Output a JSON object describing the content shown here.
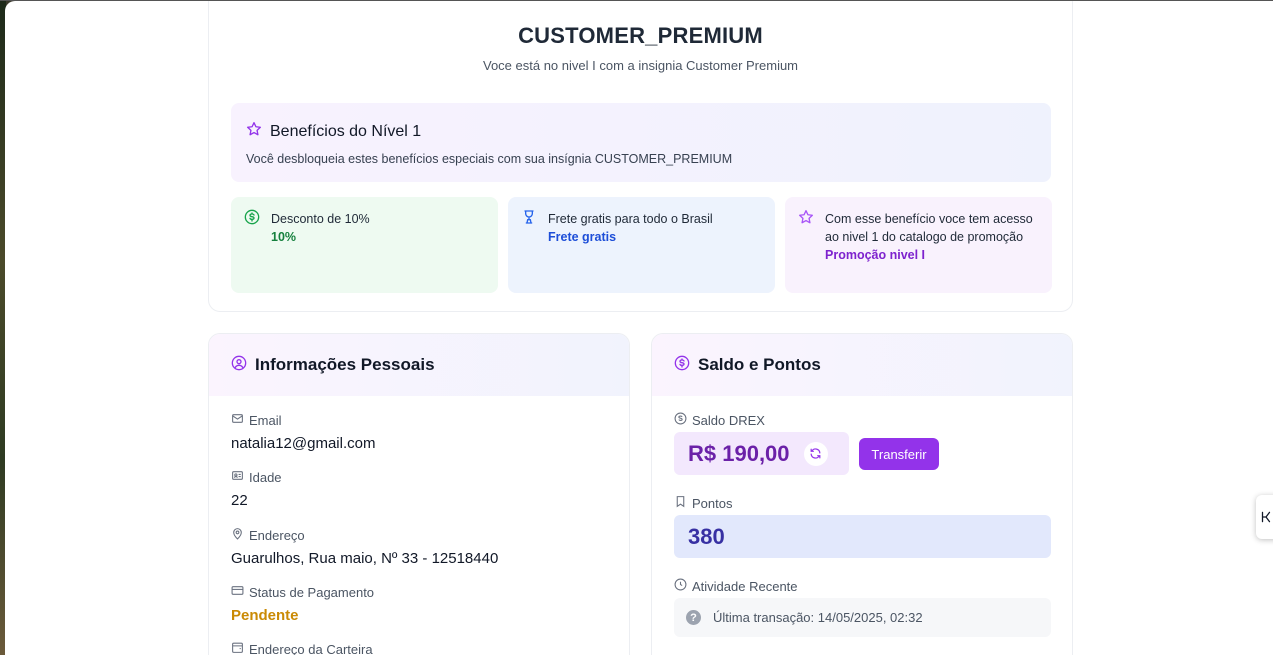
{
  "badge": {
    "title": "CUSTOMER_PREMIUM",
    "subtitle": "Voce está no nivel I com a insignia Customer Premium"
  },
  "benefits": {
    "heading": "Benefícios do Nível 1",
    "description": "Você desbloqueia estes benefícios especiais com sua insígnia CUSTOMER_PREMIUM",
    "items": [
      {
        "text": "Desconto de 10%",
        "value": "10%",
        "icon": "dollar-circle-icon",
        "color": "#15803d"
      },
      {
        "text": "Frete gratis para todo o Brasil",
        "value": "Frete gratis",
        "icon": "trophy-icon",
        "color": "#1d4ed8"
      },
      {
        "text": "Com esse benefício voce tem acesso ao nivel 1 do catalogo de promoção",
        "value": "Promoção nivel I",
        "icon": "star-icon",
        "color": "#7e22ce"
      }
    ]
  },
  "personal": {
    "heading": "Informações Pessoais",
    "fields": [
      {
        "label": "Email",
        "value": "natalia12@gmail.com",
        "icon": "mail-icon"
      },
      {
        "label": "Idade",
        "value": "22",
        "icon": "id-card-icon"
      },
      {
        "label": "Endereço",
        "value": "Guarulhos, Rua maio, Nº 33 - 12518440",
        "icon": "map-pin-icon"
      },
      {
        "label": "Status de Pagamento",
        "value": "Pendente",
        "icon": "credit-card-icon"
      },
      {
        "label": "Endereço da Carteira",
        "value": "",
        "icon": "wallet-icon"
      }
    ]
  },
  "balance": {
    "heading": "Saldo e Pontos",
    "drex_label": "Saldo DREX",
    "drex_value": "R$ 190,00",
    "transfer_label": "Transferir",
    "points_label": "Pontos",
    "points_value": "380",
    "activity_label": "Atividade Recente",
    "activity_text": "Última transação: 14/05/2025, 02:32"
  },
  "colors": {
    "accent": "#9333ea",
    "pending": "#ca8a04"
  }
}
